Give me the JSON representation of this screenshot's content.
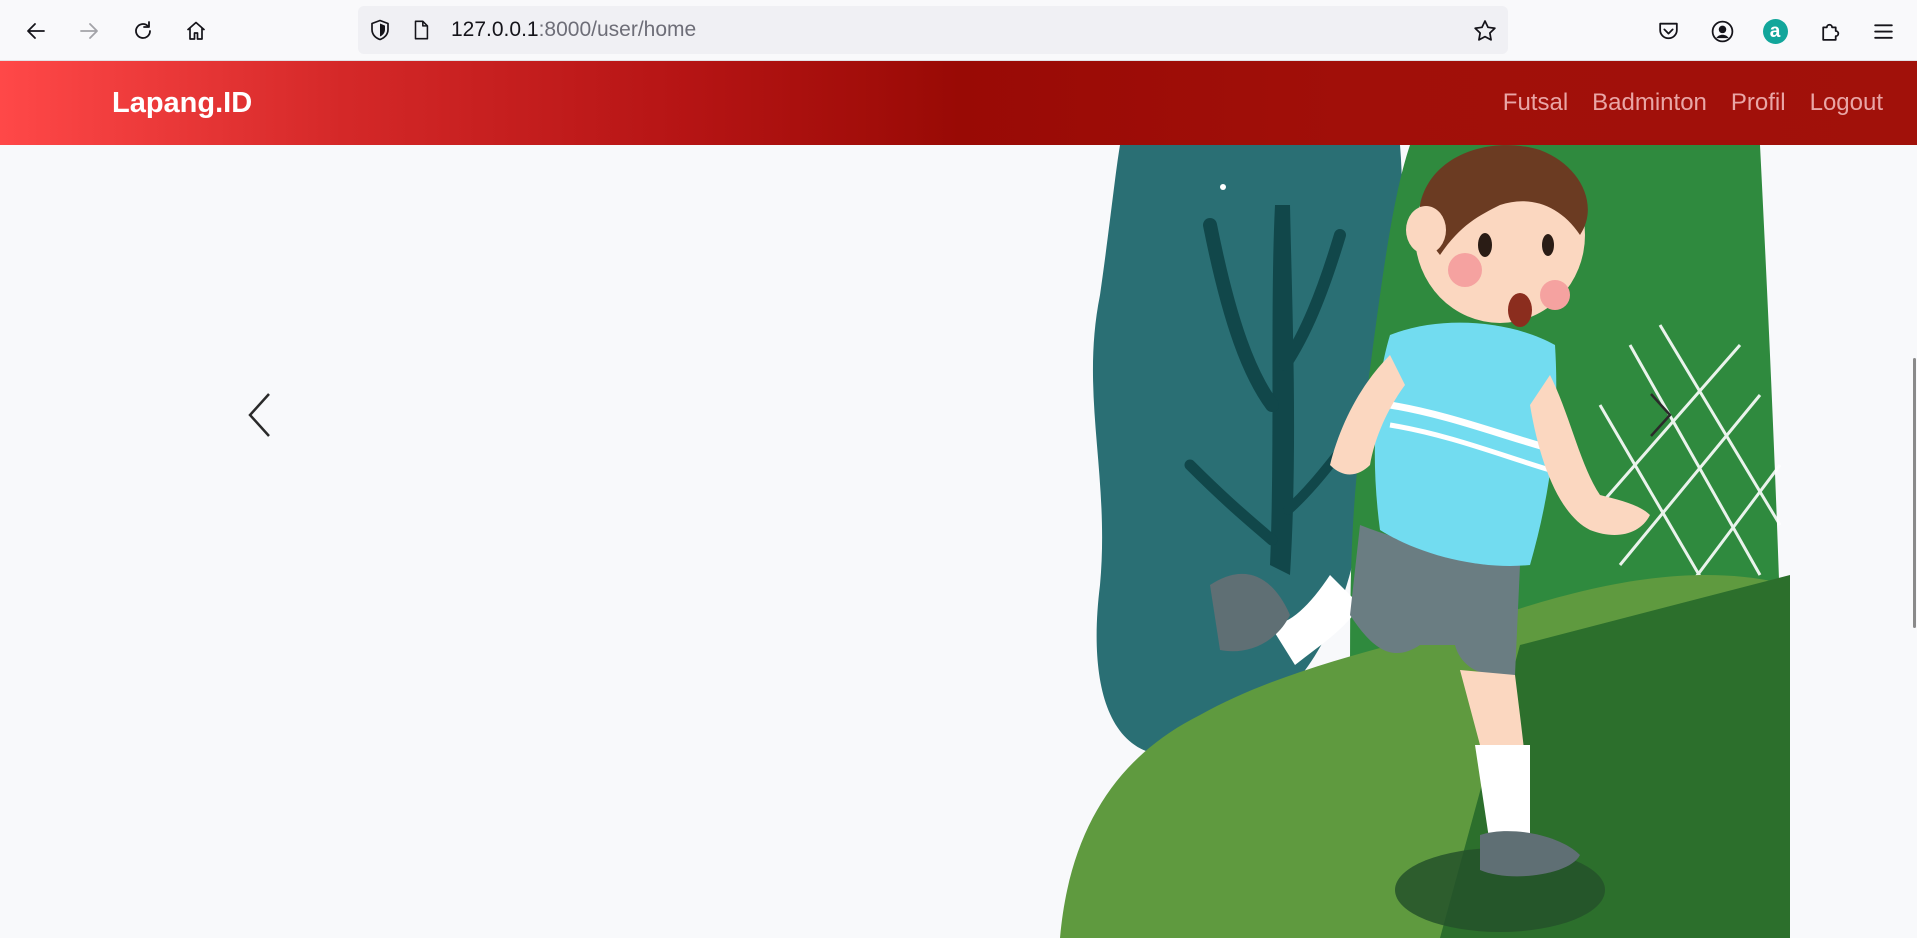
{
  "browser": {
    "url_host": "127.0.0.1",
    "url_rest": ":8000/user/home",
    "extension_badge": "a"
  },
  "site": {
    "brand": "Lapang.ID",
    "nav": [
      "Futsal",
      "Badminton",
      "Profil",
      "Logout"
    ]
  },
  "colors": {
    "nav_gradient_start": "#ff4848",
    "nav_gradient_mid": "#990a05",
    "nav_gradient_end": "#a1110a",
    "nav_link": "#e9a6a6",
    "page_background": "#f8f9fb"
  },
  "icons": {
    "back": "arrow-left-icon",
    "forward": "arrow-right-icon",
    "reload": "reload-icon",
    "home": "home-icon",
    "tracking": "shield-icon",
    "page": "page-icon",
    "bookmark": "star-icon",
    "pocket": "pocket-icon",
    "account": "account-icon",
    "extensions": "puzzle-icon",
    "menu": "hamburger-menu-icon",
    "carousel_prev": "chevron-left-icon",
    "carousel_next": "chevron-right-icon"
  }
}
